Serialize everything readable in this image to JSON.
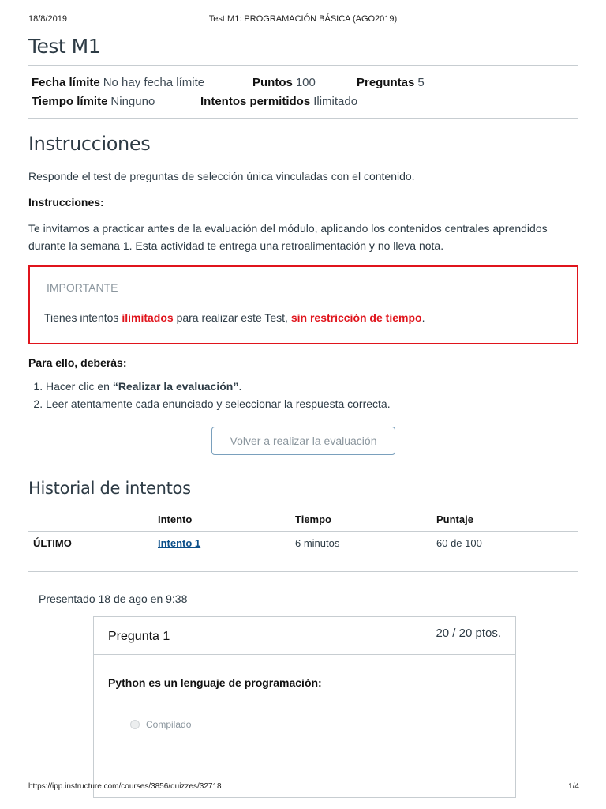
{
  "print_header": {
    "date": "18/8/2019",
    "doc_title": "Test M1: PROGRAMACIÓN BÁSICA (AGO2019)"
  },
  "quiz": {
    "title": "Test M1",
    "details": {
      "due_label": "Fecha límite",
      "due_value": "No hay fecha límite",
      "points_label": "Puntos",
      "points_value": "100",
      "questions_label": "Preguntas",
      "questions_value": "5",
      "time_label": "Tiempo límite",
      "time_value": "Ninguno",
      "attempts_label": "Intentos permitidos",
      "attempts_value": "Ilimitado"
    }
  },
  "instructions": {
    "title": "Instrucciones",
    "intro": "Responde el test de preguntas de selección única vinculadas con el contenido.",
    "subtitle": "Instrucciones:",
    "paragraph": "Te invitamos a practicar antes de la evaluación del módulo, aplicando los contenidos centrales aprendidos durante la semana 1. Esta actividad te entrega una retroalimentación y no lleva nota.",
    "important": {
      "title": "IMPORTANTE",
      "text_1": "Tienes intentos ",
      "highlight_1": "ilimitados",
      "text_2": " para realizar este Test, ",
      "highlight_2": "sin restricción de tiempo",
      "text_3": "."
    },
    "steps_title": "Para ello, deberás:",
    "step_1_prefix": "Hacer clic en ",
    "step_1_bold": "“Realizar la evaluación”",
    "step_1_suffix": ".",
    "step_2": "Leer atentamente cada enunciado y seleccionar la respuesta correcta."
  },
  "retake_button": "Volver a realizar la evaluación",
  "history": {
    "title": "Historial de intentos",
    "headers": [
      "",
      "Intento",
      "Tiempo",
      "Puntaje"
    ],
    "rows": [
      {
        "label": "ÚLTIMO",
        "attempt": "Intento 1",
        "time": "6 minutos",
        "score": "60 de 100"
      }
    ]
  },
  "submitted": "Presentado 18 de ago en 9:38",
  "question": {
    "name": "Pregunta 1",
    "points": "20 / 20 ptos.",
    "text": "Python es un lenguaje de programación:",
    "answers": [
      "Compilado"
    ]
  },
  "print_footer": {
    "url": "https://ipp.instructure.com/courses/3856/quizzes/32718",
    "page": "1/4"
  }
}
